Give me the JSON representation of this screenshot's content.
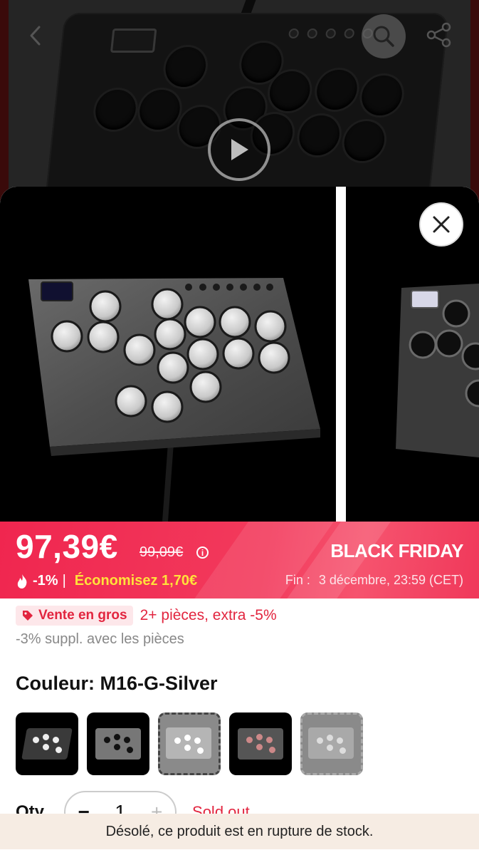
{
  "header": {
    "back_icon": "chevron-left-icon",
    "search_icon": "search-icon",
    "share_icon": "share-icon",
    "play_icon": "play-icon"
  },
  "gallery": {
    "close_icon": "close-icon"
  },
  "price": {
    "current": "97,39€",
    "original": "99,09€",
    "info_glyph": "i",
    "discount": "-1%",
    "separator": "|",
    "savings": "Économisez 1,70€",
    "promo_title": "BLACK FRIDAY",
    "end_label": "Fin :",
    "end_date": "3 décembre, 23:59 (CET)",
    "accent": "#f0264f"
  },
  "wholesale": {
    "badge": "Vente en gros",
    "offer": "2+ pièces, extra -5%",
    "extra": "-3% suppl. avec les pièces"
  },
  "color": {
    "label": "Couleur: M16-G-Silver",
    "selected_index": 2
  },
  "quantity": {
    "label": "Qty",
    "minus": "−",
    "value": "1",
    "plus": "+",
    "status": "Sold out"
  },
  "toast": {
    "message": "Désolé, ce produit est en rupture de stock."
  }
}
